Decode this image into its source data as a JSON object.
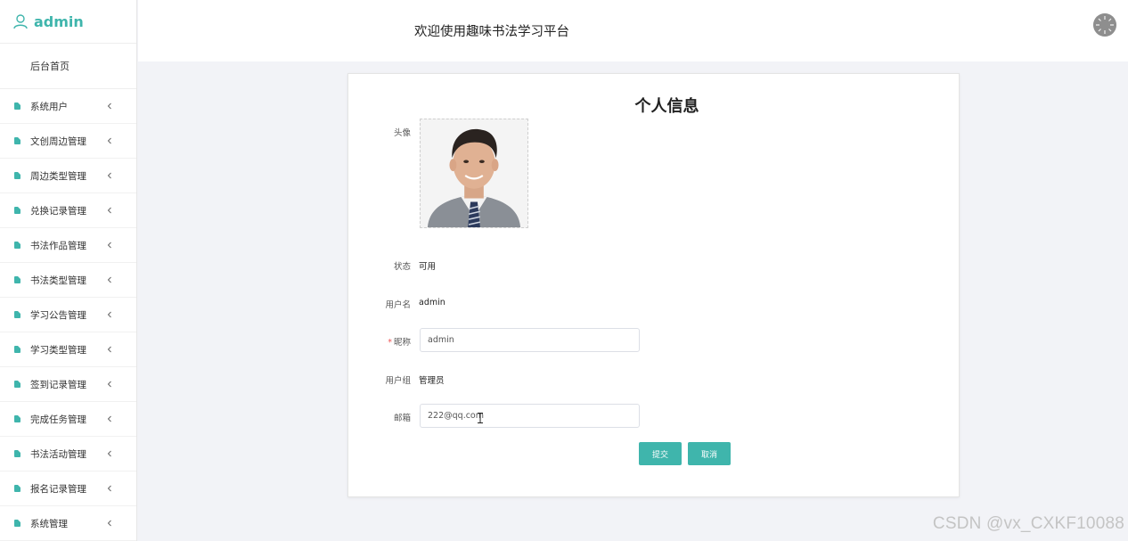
{
  "sidebar": {
    "brand": "admin",
    "home": "后台首页",
    "items": [
      {
        "label": "系统用户"
      },
      {
        "label": "文创周边管理"
      },
      {
        "label": "周边类型管理"
      },
      {
        "label": "兑换记录管理"
      },
      {
        "label": "书法作品管理"
      },
      {
        "label": "书法类型管理"
      },
      {
        "label": "学习公告管理"
      },
      {
        "label": "学习类型管理"
      },
      {
        "label": "签到记录管理"
      },
      {
        "label": "完成任务管理"
      },
      {
        "label": "书法活动管理"
      },
      {
        "label": "报名记录管理"
      },
      {
        "label": "系统管理"
      }
    ]
  },
  "header": {
    "title": "欢迎使用趣味书法学习平台"
  },
  "profile": {
    "title": "个人信息",
    "avatar_label": "头像",
    "status_label": "状态",
    "status_value": "可用",
    "username_label": "用户名",
    "username_value": "admin",
    "nickname_required": "*",
    "nickname_label": "昵称",
    "nickname_value": "admin",
    "group_label": "用户组",
    "group_value": "管理员",
    "email_label": "邮箱",
    "email_value": "222@qq.com",
    "submit_label": "提交",
    "cancel_label": "取消"
  },
  "watermark": "CSDN @vx_CXKF10088",
  "colors": {
    "accent": "#3fb5ac",
    "background": "#f2f3f7"
  }
}
